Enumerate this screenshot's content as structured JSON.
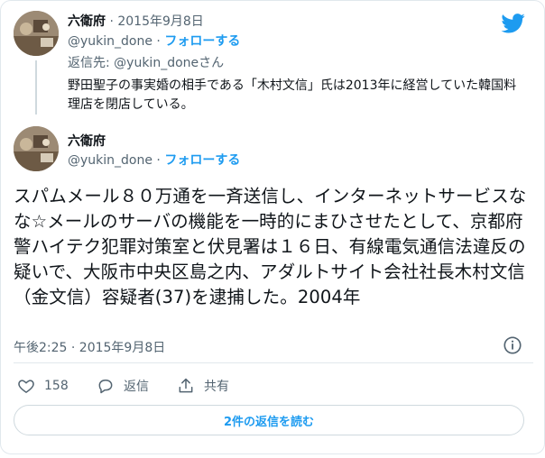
{
  "parent_tweet": {
    "name": "六衛府",
    "separator": "·",
    "date": "2015年9月8日",
    "handle": "@yukin_done",
    "follow_label": "フォローする",
    "reply_to": "返信先: @yukin_doneさん",
    "text": "野田聖子の事実婚の相手である「木村文信」氏は2013年に経営していた韓国料理店を閉店している。"
  },
  "main_tweet": {
    "name": "六衛府",
    "handle": "@yukin_done",
    "follow_label": "フォローする",
    "text": "スパムメール８０万通を一斉送信し、インターネットサービスなな☆メールのサーバの機能を一時的にまひさせたとして、京都府警ハイテク犯罪対策室と伏見署は１６日、有線電気通信法違反の疑いで、大阪市中央区島之内、アダルトサイト会社社長木村文信（金文信）容疑者(37)を逮捕した。2004年",
    "timestamp": "午後2:25 · 2015年9月8日"
  },
  "actions": {
    "like_count": "158",
    "reply_label": "返信",
    "share_label": "共有"
  },
  "read_replies_label": "2件の返信を読む",
  "colors": {
    "accent": "#1d9bf0",
    "text": "#0f1419",
    "muted": "#536471",
    "border": "#e1e8ed"
  },
  "icons": [
    "twitter-logo-icon",
    "info-icon",
    "heart-icon",
    "reply-bubble-icon",
    "share-icon"
  ]
}
